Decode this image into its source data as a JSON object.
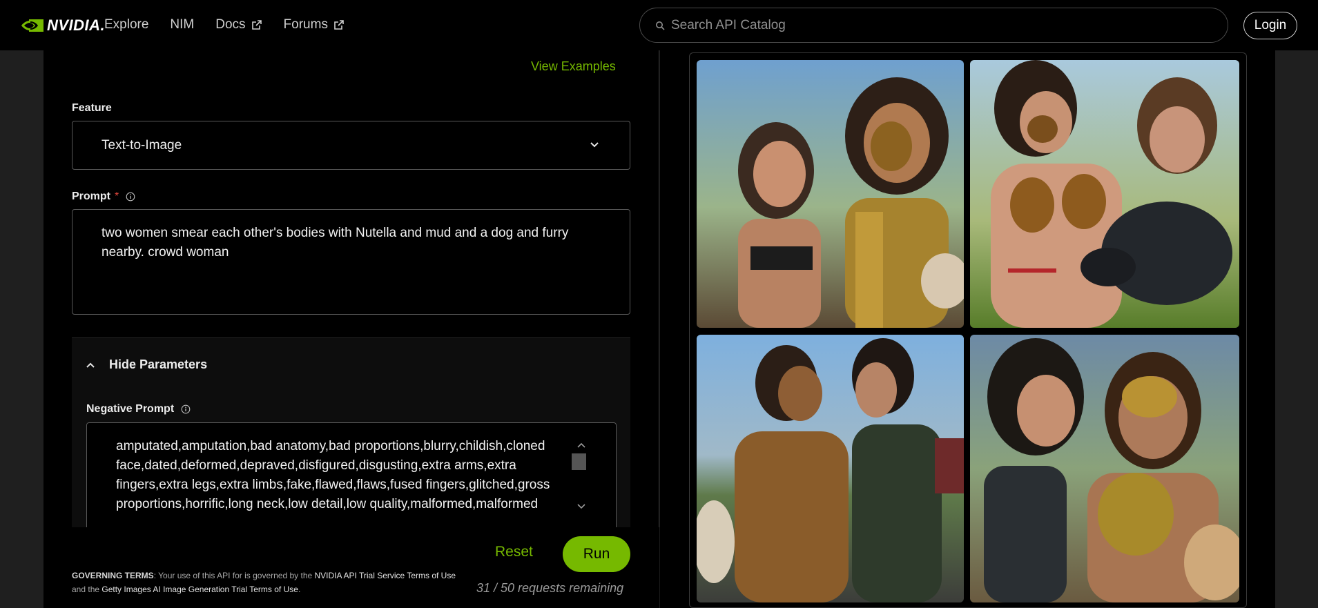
{
  "header": {
    "brand": "NVIDIA.",
    "nav": [
      {
        "label": "Explore"
      },
      {
        "label": "NIM"
      },
      {
        "label": "Docs"
      },
      {
        "label": "Forums"
      }
    ],
    "search_placeholder": "Search API Catalog",
    "login_label": "Login"
  },
  "form": {
    "view_examples": "View Examples",
    "feature_label": "Feature",
    "feature_value": "Text-to-Image",
    "prompt_label": "Prompt",
    "prompt_required": "*",
    "prompt_value": "two women smear each other's bodies with Nutella and mud and a dog and furry nearby. crowd woman",
    "params_toggle": "Hide Parameters",
    "negative_label": "Negative Prompt",
    "negative_value": "amputated,amputation,bad anatomy,bad proportions,blurry,childish,cloned face,dated,deformed,depraved,disfigured,disgusting,extra arms,extra fingers,extra legs,extra limbs,fake,flawed,flaws,fused fingers,glitched,gross proportions,horrific,long neck,low detail,low quality,malformed,malformed"
  },
  "actions": {
    "reset": "Reset",
    "run": "Run",
    "remaining": "31 / 50 requests remaining"
  },
  "terms": {
    "heading": "GOVERNING TERMS",
    "text1": ": Your use of this API for is governed by the ",
    "link1": "NVIDIA API Trial Service Terms of Use",
    "text2": " and the ",
    "link2": "Getty Images AI Image Generation Trial Terms of Use",
    "text3": "."
  },
  "colors": {
    "accent": "#76b900",
    "required": "#e0473d"
  },
  "icons": {
    "search": "search-icon",
    "external": "external-link-icon",
    "info": "info-icon",
    "chevron_down": "chevron-down-icon",
    "chevron_up": "chevron-up-icon"
  }
}
